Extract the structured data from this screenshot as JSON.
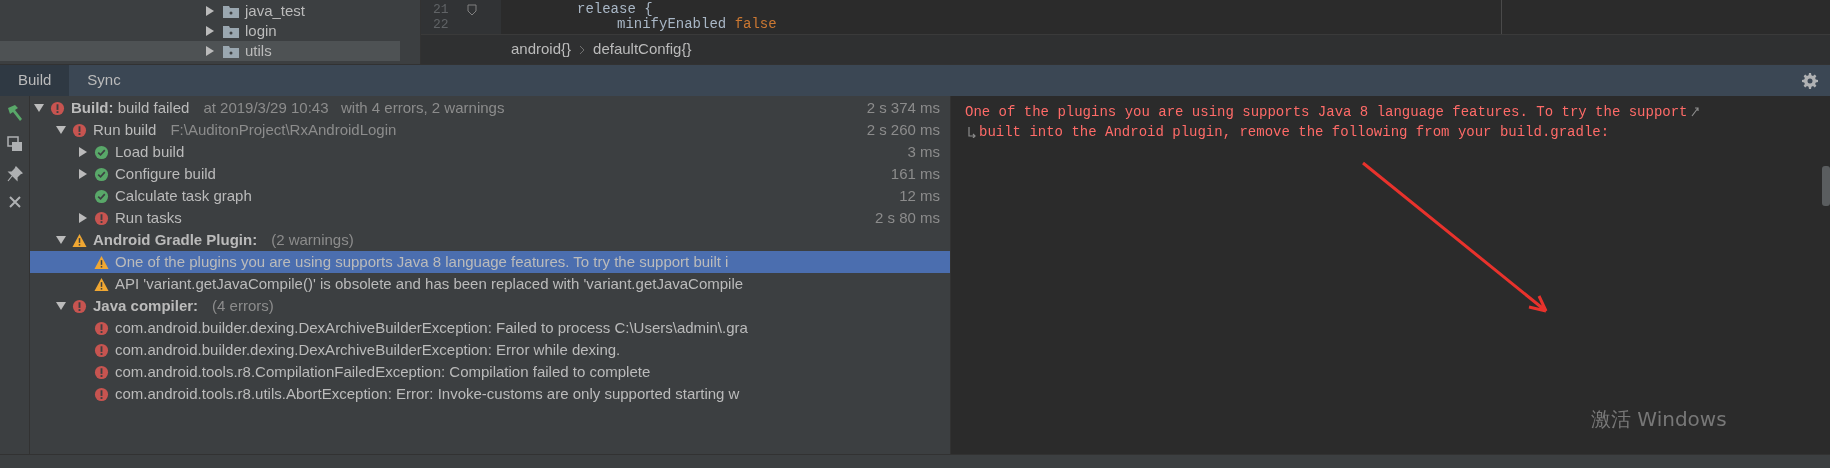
{
  "project_tree": {
    "items": [
      {
        "label": "java_test",
        "expanded": false,
        "selected": false
      },
      {
        "label": "login",
        "expanded": false,
        "selected": false
      },
      {
        "label": "utils",
        "expanded": false,
        "selected": true
      }
    ]
  },
  "editor": {
    "lines": [
      {
        "number": "21",
        "fold": true,
        "segments": [
          {
            "text": "release {",
            "kind": "plain"
          }
        ]
      },
      {
        "number": "22",
        "fold": false,
        "segments": [
          {
            "text": "minifyEnabled ",
            "kind": "plain"
          },
          {
            "text": "false",
            "kind": "keyword"
          }
        ]
      }
    ],
    "breadcrumbs": [
      "android{}",
      "defaultConfig{}"
    ]
  },
  "tabs": [
    {
      "label": "Build",
      "selected": true
    },
    {
      "label": "Sync",
      "selected": false
    }
  ],
  "build_tree": [
    {
      "kind": "error",
      "label": "Build:",
      "title": "build failed",
      "detail": "at 2019/3/29 10:43   with 4 errors, 2 warnings",
      "duration": "2 s 374 ms",
      "expanded": true,
      "selected": false,
      "children": [
        {
          "kind": "error",
          "label": "Run build",
          "detail": "F:\\AuditonProject\\RxAndroidLogin",
          "duration": "2 s 260 ms",
          "expanded": true,
          "selected": false,
          "children": [
            {
              "kind": "ok",
              "label": "Load build",
              "duration": "3 ms",
              "expanded": false,
              "selected": false
            },
            {
              "kind": "ok",
              "label": "Configure build",
              "duration": "161 ms",
              "expanded": false,
              "selected": false
            },
            {
              "kind": "ok",
              "label": "Calculate task graph",
              "duration": "12 ms",
              "selected": false
            },
            {
              "kind": "error",
              "label": "Run tasks",
              "duration": "2 s 80 ms",
              "expanded": false,
              "selected": false
            }
          ]
        },
        {
          "kind": "warning",
          "label": "Android Gradle Plugin:",
          "bold": true,
          "detail": "(2 warnings)",
          "expanded": true,
          "selected": false,
          "children": [
            {
              "kind": "warning",
              "label": "One of the plugins you are using supports Java 8 language features. To try the support built i",
              "selected": true
            },
            {
              "kind": "warning",
              "label": "API 'variant.getJavaCompile()' is obsolete and has been replaced with 'variant.getJavaCompile",
              "selected": false
            }
          ]
        },
        {
          "kind": "error",
          "label": "Java compiler:",
          "bold": true,
          "detail": "(4 errors)",
          "expanded": true,
          "selected": false,
          "children": [
            {
              "kind": "error",
              "label": "com.android.builder.dexing.DexArchiveBuilderException: Failed to process C:\\Users\\admin\\.gra",
              "selected": false
            },
            {
              "kind": "error",
              "label": "com.android.builder.dexing.DexArchiveBuilderException: Error while dexing.",
              "selected": false
            },
            {
              "kind": "error",
              "label": "com.android.tools.r8.CompilationFailedException: Compilation failed to complete",
              "selected": false
            },
            {
              "kind": "error",
              "label": "com.android.tools.r8.utils.AbortException: Error: Invoke-customs are only supported starting w",
              "selected": false
            }
          ]
        }
      ]
    }
  ],
  "console": {
    "lines": [
      {
        "text": "One of the plugins you are using supports Java 8 language features. To try the support",
        "wrapped_before": false,
        "wraps_after": true
      },
      {
        "text": "built into the Android plugin, remove the following from your build.gradle:",
        "wrapped_before": true,
        "wraps_after": false
      }
    ]
  },
  "os_notice": "激活 Windows"
}
